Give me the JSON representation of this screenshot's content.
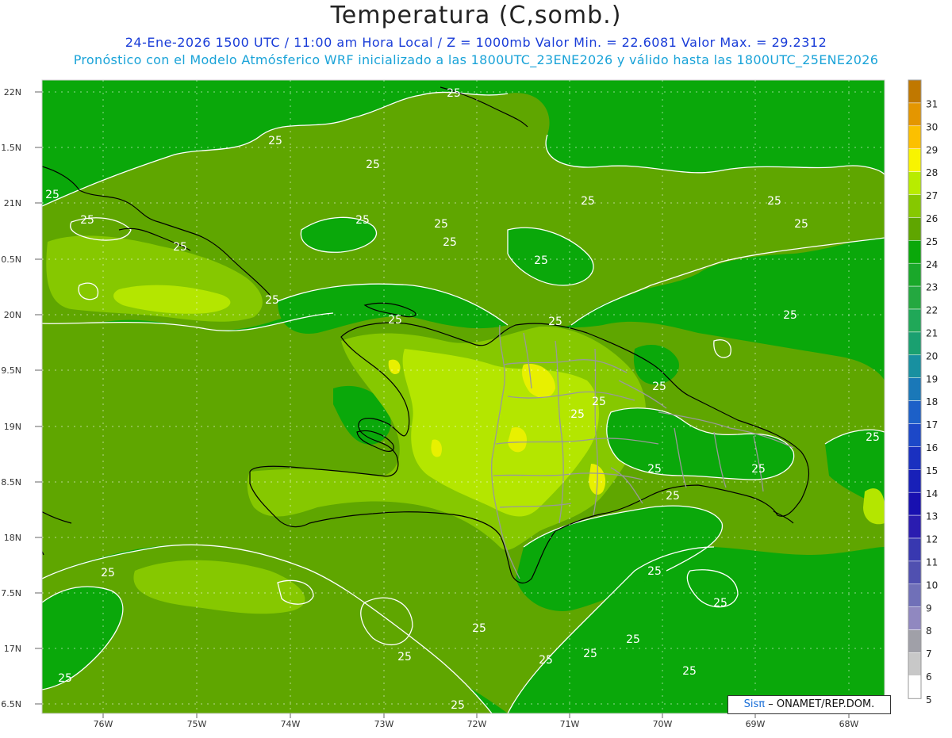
{
  "header": {
    "title": "Temperatura (C,somb.)",
    "line1": "24-Ene-2026 1500 UTC / 11:00 am Hora Local / Z = 1000mb   Valor Min. = 22.6081  Valor Max. = 29.2312",
    "line2": "Pronóstico con el Modelo Atmósferico WRF inicializado a las 1800UTC_23ENE2026 y válido hasta las  1800UTC_25ENE2026"
  },
  "map": {
    "lat_labels": [
      "22N",
      "1.5N",
      "21N",
      "0.5N",
      "20N",
      "9.5N",
      "19N",
      "8.5N",
      "18N",
      "7.5N",
      "17N",
      "6.5N"
    ],
    "lon_labels": [
      "76W",
      "75W",
      "74W",
      "73W",
      "72W",
      "71W",
      "70W",
      "69W",
      "68W"
    ],
    "contour_label": "25",
    "colors": {
      "ocean_24": "#0aa80a",
      "land_25": "#5fa600",
      "warm_26": "#86c800",
      "warm_27": "#b4e600",
      "warm_28": "#e8f000",
      "contour": "#ffffff",
      "coast": "#000000",
      "border": "#999999"
    }
  },
  "colorbar": {
    "labels": [
      "31",
      "30",
      "29",
      "28",
      "27",
      "26",
      "25",
      "24",
      "23",
      "22",
      "21",
      "20",
      "19",
      "18",
      "17",
      "16",
      "15",
      "14",
      "13",
      "12",
      "11",
      "10",
      "9",
      "8",
      "7",
      "6",
      "5"
    ],
    "colors": [
      "#c07800",
      "#e49600",
      "#fcc000",
      "#f8f400",
      "#b8ec00",
      "#86c800",
      "#5fa600",
      "#0aa80a",
      "#1aa82a",
      "#24a840",
      "#20a858",
      "#1aa070",
      "#1890a0",
      "#1a78b8",
      "#1c60c8",
      "#1c48c8",
      "#1a30c0",
      "#1820b8",
      "#1810b0",
      "#2a1cb0",
      "#3838b0",
      "#5050b0",
      "#7070b8",
      "#9088c0",
      "#a0a0a8",
      "#c8c8c8",
      "#ffffff"
    ]
  },
  "credit": {
    "sis": "Sisπ",
    "rest": "– ONAMET/REP.DOM."
  }
}
